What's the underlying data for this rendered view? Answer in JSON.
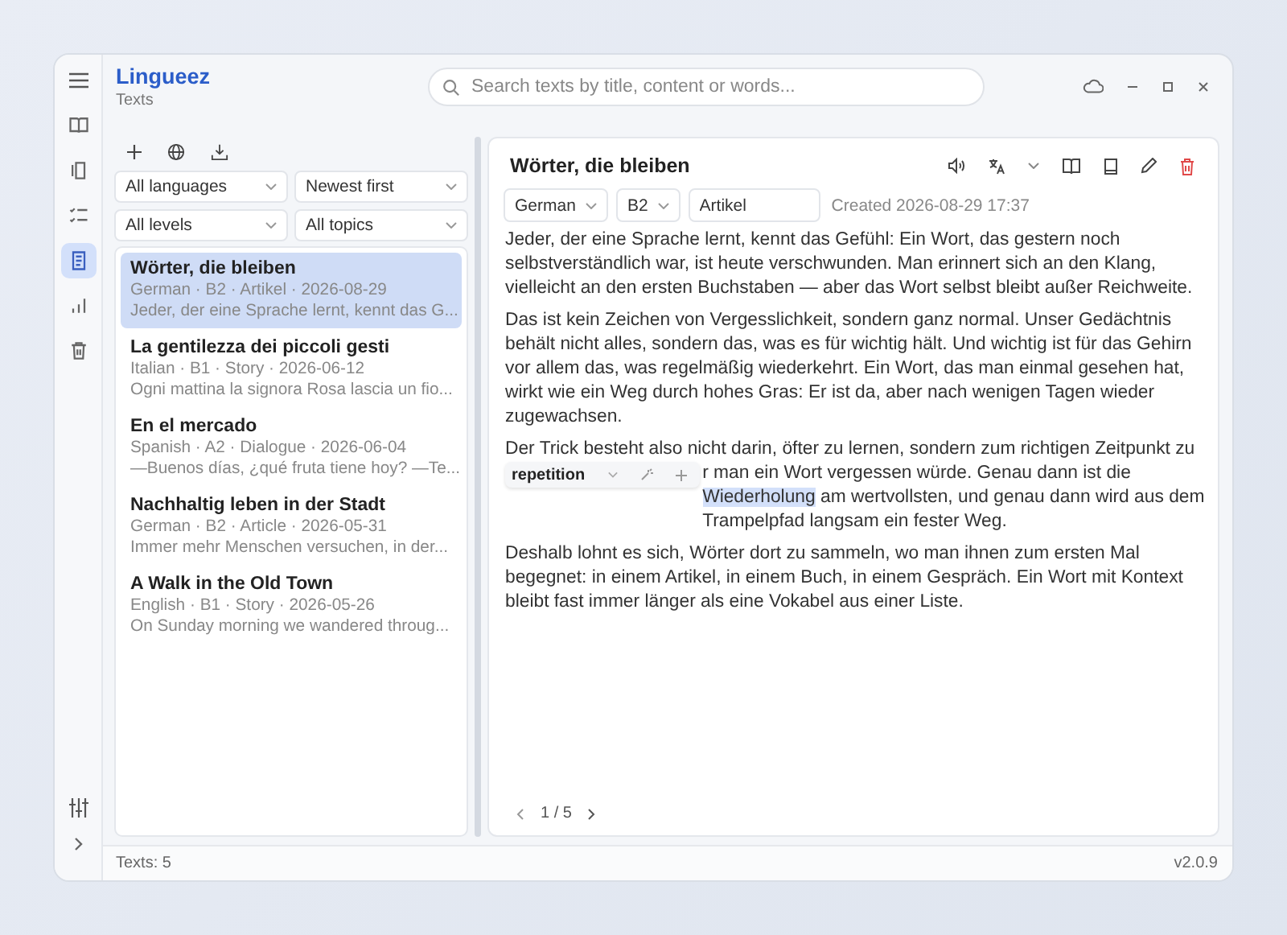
{
  "app": {
    "title": "Lingueez",
    "subtitle": "Texts"
  },
  "rail": {
    "items": [
      {
        "selected": false
      },
      {
        "selected": false
      },
      {
        "selected": false
      },
      {
        "selected": true
      },
      {
        "selected": false
      },
      {
        "selected": false
      }
    ]
  },
  "search": {
    "placeholder": "Search texts by title, content or words..."
  },
  "filters": [
    {
      "value": "All languages"
    },
    {
      "value": "Newest first"
    },
    {
      "value": "All levels"
    },
    {
      "value": "All topics"
    }
  ],
  "texts": [
    {
      "title": "Wörter, die bleiben",
      "meta": "German · B2 · Artikel · 2026-08-29",
      "preview": "Jeder, der eine Sprache lernt, kennt das G...",
      "selected": true
    },
    {
      "title": "La gentilezza dei piccoli gesti",
      "meta": "Italian · B1 · Story · 2026-06-12",
      "preview": "Ogni mattina la signora Rosa lascia un fio...",
      "selected": false
    },
    {
      "title": "En el mercado",
      "meta": "Spanish · A2 · Dialogue · 2026-06-04",
      "preview": "—Buenos días, ¿qué fruta tiene hoy? —Te...",
      "selected": false
    },
    {
      "title": "Nachhaltig leben in der Stadt",
      "meta": "German · B2 · Article · 2026-05-31",
      "preview": "Immer mehr Menschen versuchen, in der...",
      "selected": false
    },
    {
      "title": "A Walk in the Old Town",
      "meta": "English · B1 · Story · 2026-05-26",
      "preview": "On Sunday morning we wandered throug...",
      "selected": false
    }
  ],
  "detail": {
    "title": "Wörter, die bleiben",
    "language": "German",
    "level": "B2",
    "topic": "Artikel",
    "created": "Created 2026-08-29 17:37",
    "paragraphs": [
      {
        "text": "Jeder, der eine Sprache lernt, kennt das Gefühl: Ein Wort, das gestern noch selbstverständlich war, ist heute verschwunden. Man erinnert sich an den Klang, vielleicht an den ersten Buchstaben — aber das Wort selbst bleibt außer Reichweite."
      },
      {
        "text": "Das ist kein Zeichen von Vergesslichkeit, sondern ganz normal. Unser Gedächtnis behält nicht alles, sondern das, was es für wichtig hält. Und wichtig ist für das Gehirn vor allem das, was regelmäßig wiederkehrt. Ein Wort, das man einmal gesehen hat, wirkt wie ein Weg durch hohes Gras: Er ist da, aber nach wenigen Tagen wieder zugewachsen."
      },
      {
        "first_line": "Der Trick besteht also nicht darin, öfter zu lernen, sondern zum richtigen Zeitpunkt zu",
        "popup": {
          "translation": "repetition"
        },
        "before": "r man ein Wort vergessen würde. Genau dann ist die ",
        "highlight": "Wiederholung",
        "after": " am wertvollsten, und genau dann wird aus dem Trampelpfad langsam ein fester Weg."
      },
      {
        "text": "Deshalb lohnt es sich, Wörter dort zu sammeln, wo man ihnen zum ersten Mal begegnet: in einem Artikel, in einem Buch, in einem Gespräch. Ein Wort mit Kontext bleibt fast immer länger als eine Vokabel aus einer Liste."
      }
    ],
    "page": "1 / 5"
  },
  "status_bar": {
    "count": "Texts: 5",
    "version": "v2.0.9"
  }
}
